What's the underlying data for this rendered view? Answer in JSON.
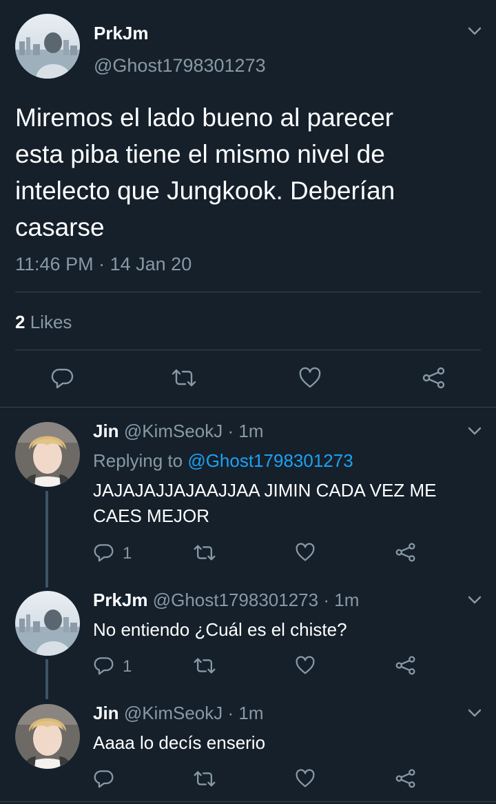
{
  "main_tweet": {
    "display_name": "PrkJm",
    "handle": "@Ghost1798301273",
    "text_lines": [
      "Miremos el lado bueno al parecer",
      "esta piba tiene el mismo nivel de",
      "intelecto que Jungkook. Deberían",
      "casarse"
    ],
    "time": "11:46 PM",
    "dot": "·",
    "date": "14 Jan 20",
    "likes_count": "2",
    "likes_label": "Likes",
    "avatar_icon": "profile-photo-city",
    "actions": [
      "reply-icon",
      "retweet-icon",
      "like-icon",
      "share-icon"
    ]
  },
  "replies": [
    {
      "display_name": "Jin",
      "handle": "@KimSeokJ",
      "dot": "·",
      "time": "1m",
      "replying_to_label": "Replying to",
      "replying_to_handle": "@Ghost1798301273",
      "text_lines": [
        "JAJAJAJJAJAAJJAA JIMIN CADA VEZ ME",
        "CAES MEJOR"
      ],
      "reply_count": "1",
      "avatar_icon": "profile-photo-blond"
    },
    {
      "display_name": "PrkJm",
      "handle": "@Ghost1798301273",
      "dot": "·",
      "time": "1m",
      "text_lines": [
        "No entiendo ¿Cuál es el chiste?"
      ],
      "reply_count": "1",
      "avatar_icon": "profile-photo-city"
    },
    {
      "display_name": "Jin",
      "handle": "@KimSeokJ",
      "dot": "·",
      "time": "1m",
      "text_lines": [
        "Aaaa lo decís enserio"
      ],
      "reply_count": "",
      "avatar_icon": "profile-photo-blond"
    }
  ],
  "colors": {
    "background": "#15202b",
    "text": "#ffffff",
    "muted": "#8899a6",
    "link": "#1da1f2",
    "separator": "#38444d"
  }
}
